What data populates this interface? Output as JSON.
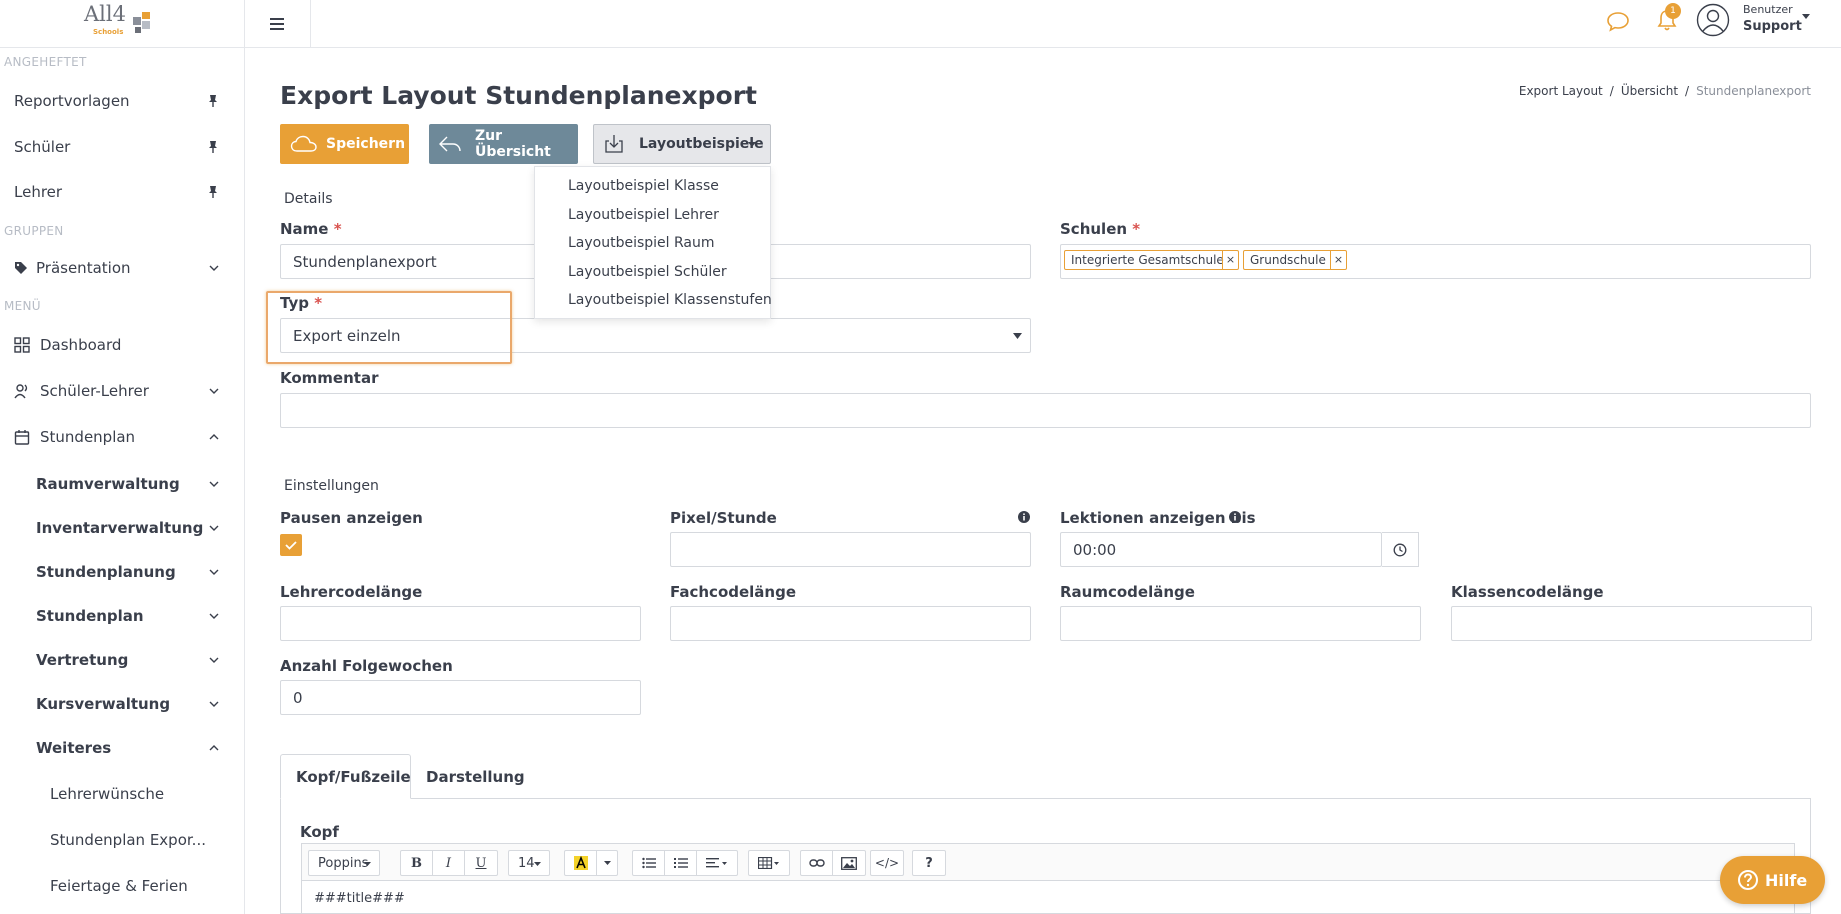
{
  "brand": {
    "logo_text": "All4",
    "logo_sub": "Schools"
  },
  "topbar": {
    "notification_count": "1",
    "user_line1": "Benutzer",
    "user_line2": "Support"
  },
  "sidebar": {
    "section_pinned": "ANGEHEFTET",
    "pinned": [
      "Reportvorlagen",
      "Schüler",
      "Lehrer"
    ],
    "section_groups": "GRUPPEN",
    "groups": [
      "Präsentation"
    ],
    "section_menu": "MENÜ",
    "menu": [
      "Dashboard",
      "Schüler-Lehrer",
      "Stundenplan"
    ],
    "stundenplan_sub": [
      "Raumverwaltung",
      "Inventarverwaltung",
      "Stundenplanung",
      "Stundenplan",
      "Vertretung",
      "Kursverwaltung",
      "Weiteres"
    ],
    "weiteres_sub": [
      "Lehrerwünsche",
      "Stundenplan Expor...",
      "Feiertage & Ferien"
    ]
  },
  "page": {
    "title": "Export Layout Stundenplanexport",
    "breadcrumb": [
      "Export Layout",
      "Übersicht",
      "Stundenplanexport"
    ]
  },
  "buttons": {
    "save": "Speichern",
    "overview": "Zur Übersicht",
    "examples": "Layoutbeispiele"
  },
  "examples_menu": [
    "Layoutbeispiel Klasse",
    "Layoutbeispiel Lehrer",
    "Layoutbeispiel Raum",
    "Layoutbeispiel Schüler",
    "Layoutbeispiel Klassenstufen"
  ],
  "details": {
    "section": "Details",
    "name_label": "Name",
    "name_value": "Stundenplanexport",
    "schools_label": "Schulen",
    "schools": [
      "Integrierte Gesamtschule",
      "Grundschule"
    ],
    "type_label": "Typ",
    "type_value": "Export einzeln",
    "comment_label": "Kommentar",
    "comment_value": "",
    "required_mark": "*"
  },
  "settings": {
    "section": "Einstellungen",
    "show_breaks_label": "Pausen anzeigen",
    "show_breaks_checked": true,
    "pixel_hour_label": "Pixel/Stunde",
    "pixel_hour_value": "",
    "lessons_until_label": "Lektionen anzeigen bis",
    "lessons_until_value": "00:00",
    "teacher_code_label": "Lehrercodelänge",
    "subject_code_label": "Fachcodelänge",
    "room_code_label": "Raumcodelänge",
    "class_code_label": "Klassencodelänge",
    "following_weeks_label": "Anzahl Folgewochen",
    "following_weeks_value": "0"
  },
  "tabs": [
    "Kopf/Fußzeile",
    "Darstellung"
  ],
  "editor": {
    "label": "Kopf",
    "font": "Poppins",
    "font_size": "14",
    "content": "###title###"
  },
  "help": {
    "label": "Hilfe"
  },
  "colors": {
    "accent": "#e8a036",
    "secondary_button": "#6e8999"
  }
}
